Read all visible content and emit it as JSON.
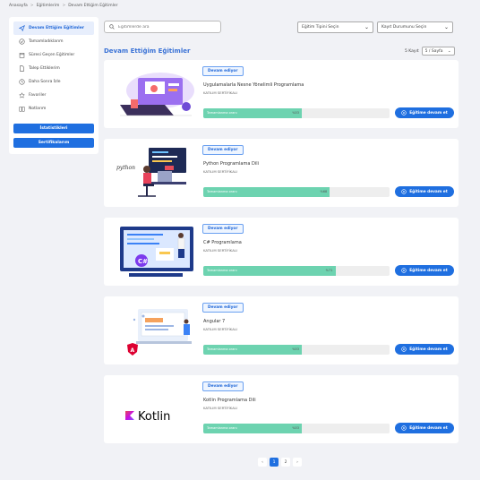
{
  "breadcrumb": [
    "Anasayfa",
    "Eğitimlerim",
    "Devam Ettiğim Eğitimler"
  ],
  "sidebar": {
    "items": [
      {
        "label": "Devam Ettiğim Eğitimler",
        "icon": "send-icon",
        "active": true
      },
      {
        "label": "Tamamladıklarım",
        "icon": "check-circle-icon"
      },
      {
        "label": "Süresi Geçen Eğitimler",
        "icon": "calendar-icon"
      },
      {
        "label": "Talep Ettiklerim",
        "icon": "document-icon"
      },
      {
        "label": "Daha Sonra İzle",
        "icon": "clock-icon"
      },
      {
        "label": "Favoriler",
        "icon": "star-icon"
      },
      {
        "label": "Notlarım",
        "icon": "book-icon"
      }
    ],
    "buttons": [
      "İstatistikleri",
      "Sertifikalarım"
    ]
  },
  "search": {
    "placeholder": "Eğitimlerde ara"
  },
  "filters": {
    "type_select": "Eğitim Tipini Seçin",
    "status_select": "Kayıt Durumunu Seçin"
  },
  "section_title": "Devam Ettiğim Eğitimler",
  "records": {
    "count_label": "5 Kayıt",
    "per_page": "5 / Sayfa"
  },
  "cards": [
    {
      "badge": "Devam ediyor",
      "title": "Uygulamalarla Nesne Yönelimli Programlama",
      "cert": "KATILIM SERTİFİKALI",
      "progress_label": "Tamamlanma oranı",
      "progress": 53,
      "progress_text": "%53",
      "cta": "Eğitime devam et",
      "thumb": "oop-illustration"
    },
    {
      "badge": "Devam ediyor",
      "title": "Python Programlama Dili",
      "cert": "KATILIM SERTİFİKALI",
      "progress_label": "Tamamlanma oranı",
      "progress": 68,
      "progress_text": "%68",
      "cta": "Eğitime devam et",
      "thumb": "python-illustration",
      "thumb_text": "python"
    },
    {
      "badge": "Devam ediyor",
      "title": "C# Programlama",
      "cert": "KATILIM SERTİFİKALI",
      "progress_label": "Tamamlanma oranı",
      "progress": 71,
      "progress_text": "%71",
      "cta": "Eğitime devam et",
      "thumb": "csharp-illustration"
    },
    {
      "badge": "Devam ediyor",
      "title": "Angular 7",
      "cert": "KATILIM SERTİFİKALI",
      "progress_label": "Tamamlanma oranı",
      "progress": 53,
      "progress_text": "%53",
      "cta": "Eğitime devam et",
      "thumb": "angular-illustration"
    },
    {
      "badge": "Devam ediyor",
      "title": "Kotlin Programlama Dili",
      "cert": "KATILIM SERTİFİKALI",
      "progress_label": "Tamamlanma oranı",
      "progress": 53,
      "progress_text": "%53",
      "cta": "Eğitime devam et",
      "thumb": "kotlin-logo",
      "thumb_text": "Kotlin"
    }
  ],
  "pagination": {
    "prev": "‹",
    "pages": [
      "1",
      "2"
    ],
    "next": "›",
    "active": "1"
  },
  "colors": {
    "accent": "#1f6fe0",
    "progress": "#6dd3b0",
    "title": "#3a72d6"
  }
}
